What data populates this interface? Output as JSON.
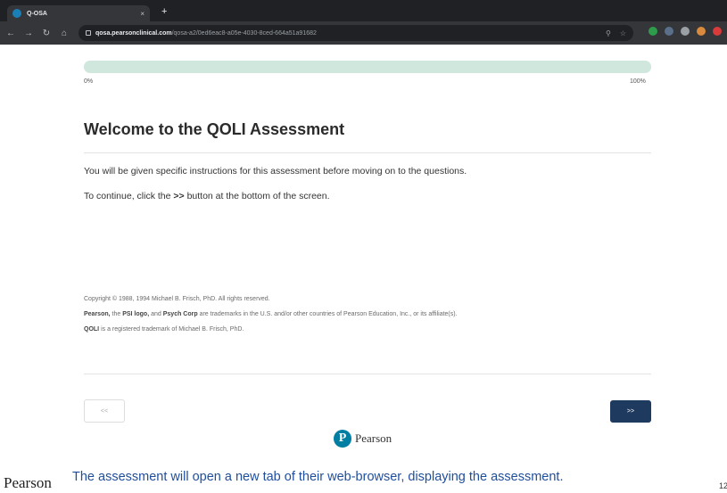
{
  "browser": {
    "tab_title": "Q-OSA",
    "tab_close": "×",
    "new_tab": "+",
    "url_host": "qosa.pearsonclinical.com",
    "url_path": "/qosa-a2/0ed6eac8-a05e-4030-8ced-664a51a91682"
  },
  "progress": {
    "value": 0,
    "min_label": "0%",
    "max_label": "100%"
  },
  "main": {
    "heading": "Welcome to the QOLI Assessment",
    "instruction_1": "You will be given specific instructions for this assessment before moving on to the questions.",
    "instruction_2_pre": "To continue, click the ",
    "instruction_2_btn": ">>",
    "instruction_2_post": " button at the bottom of the screen."
  },
  "legal": {
    "copyright": "Copyright © 1988, 1994 Michael B. Frisch, PhD. All rights reserved.",
    "tm_pearson": "Pearson,",
    "tm_the": " the ",
    "tm_psi": "PSI logo,",
    "tm_and": " and ",
    "tm_psych": "Psych Corp",
    "tm_rest": " are trademarks in the U.S. and/or other countries of Pearson Education, Inc., or its affiliate(s).",
    "qoli_bold": "QOLI",
    "qoli_rest": " is a registered trademark of Michael B. Frisch, PhD."
  },
  "nav": {
    "prev_label": "<<",
    "next_label": ">>"
  },
  "brand": {
    "logo_letter": "P",
    "name": "Pearson"
  },
  "slide": {
    "brand": "Pearson",
    "caption": "The assessment will open a new tab of their web-browser, displaying the assessment.",
    "page_number": "12"
  },
  "colors": {
    "progress_track": "#cfe7dd",
    "next_button": "#1e3a5f",
    "pearson_blue": "#007fa3",
    "caption_blue": "#1f4e9c"
  }
}
